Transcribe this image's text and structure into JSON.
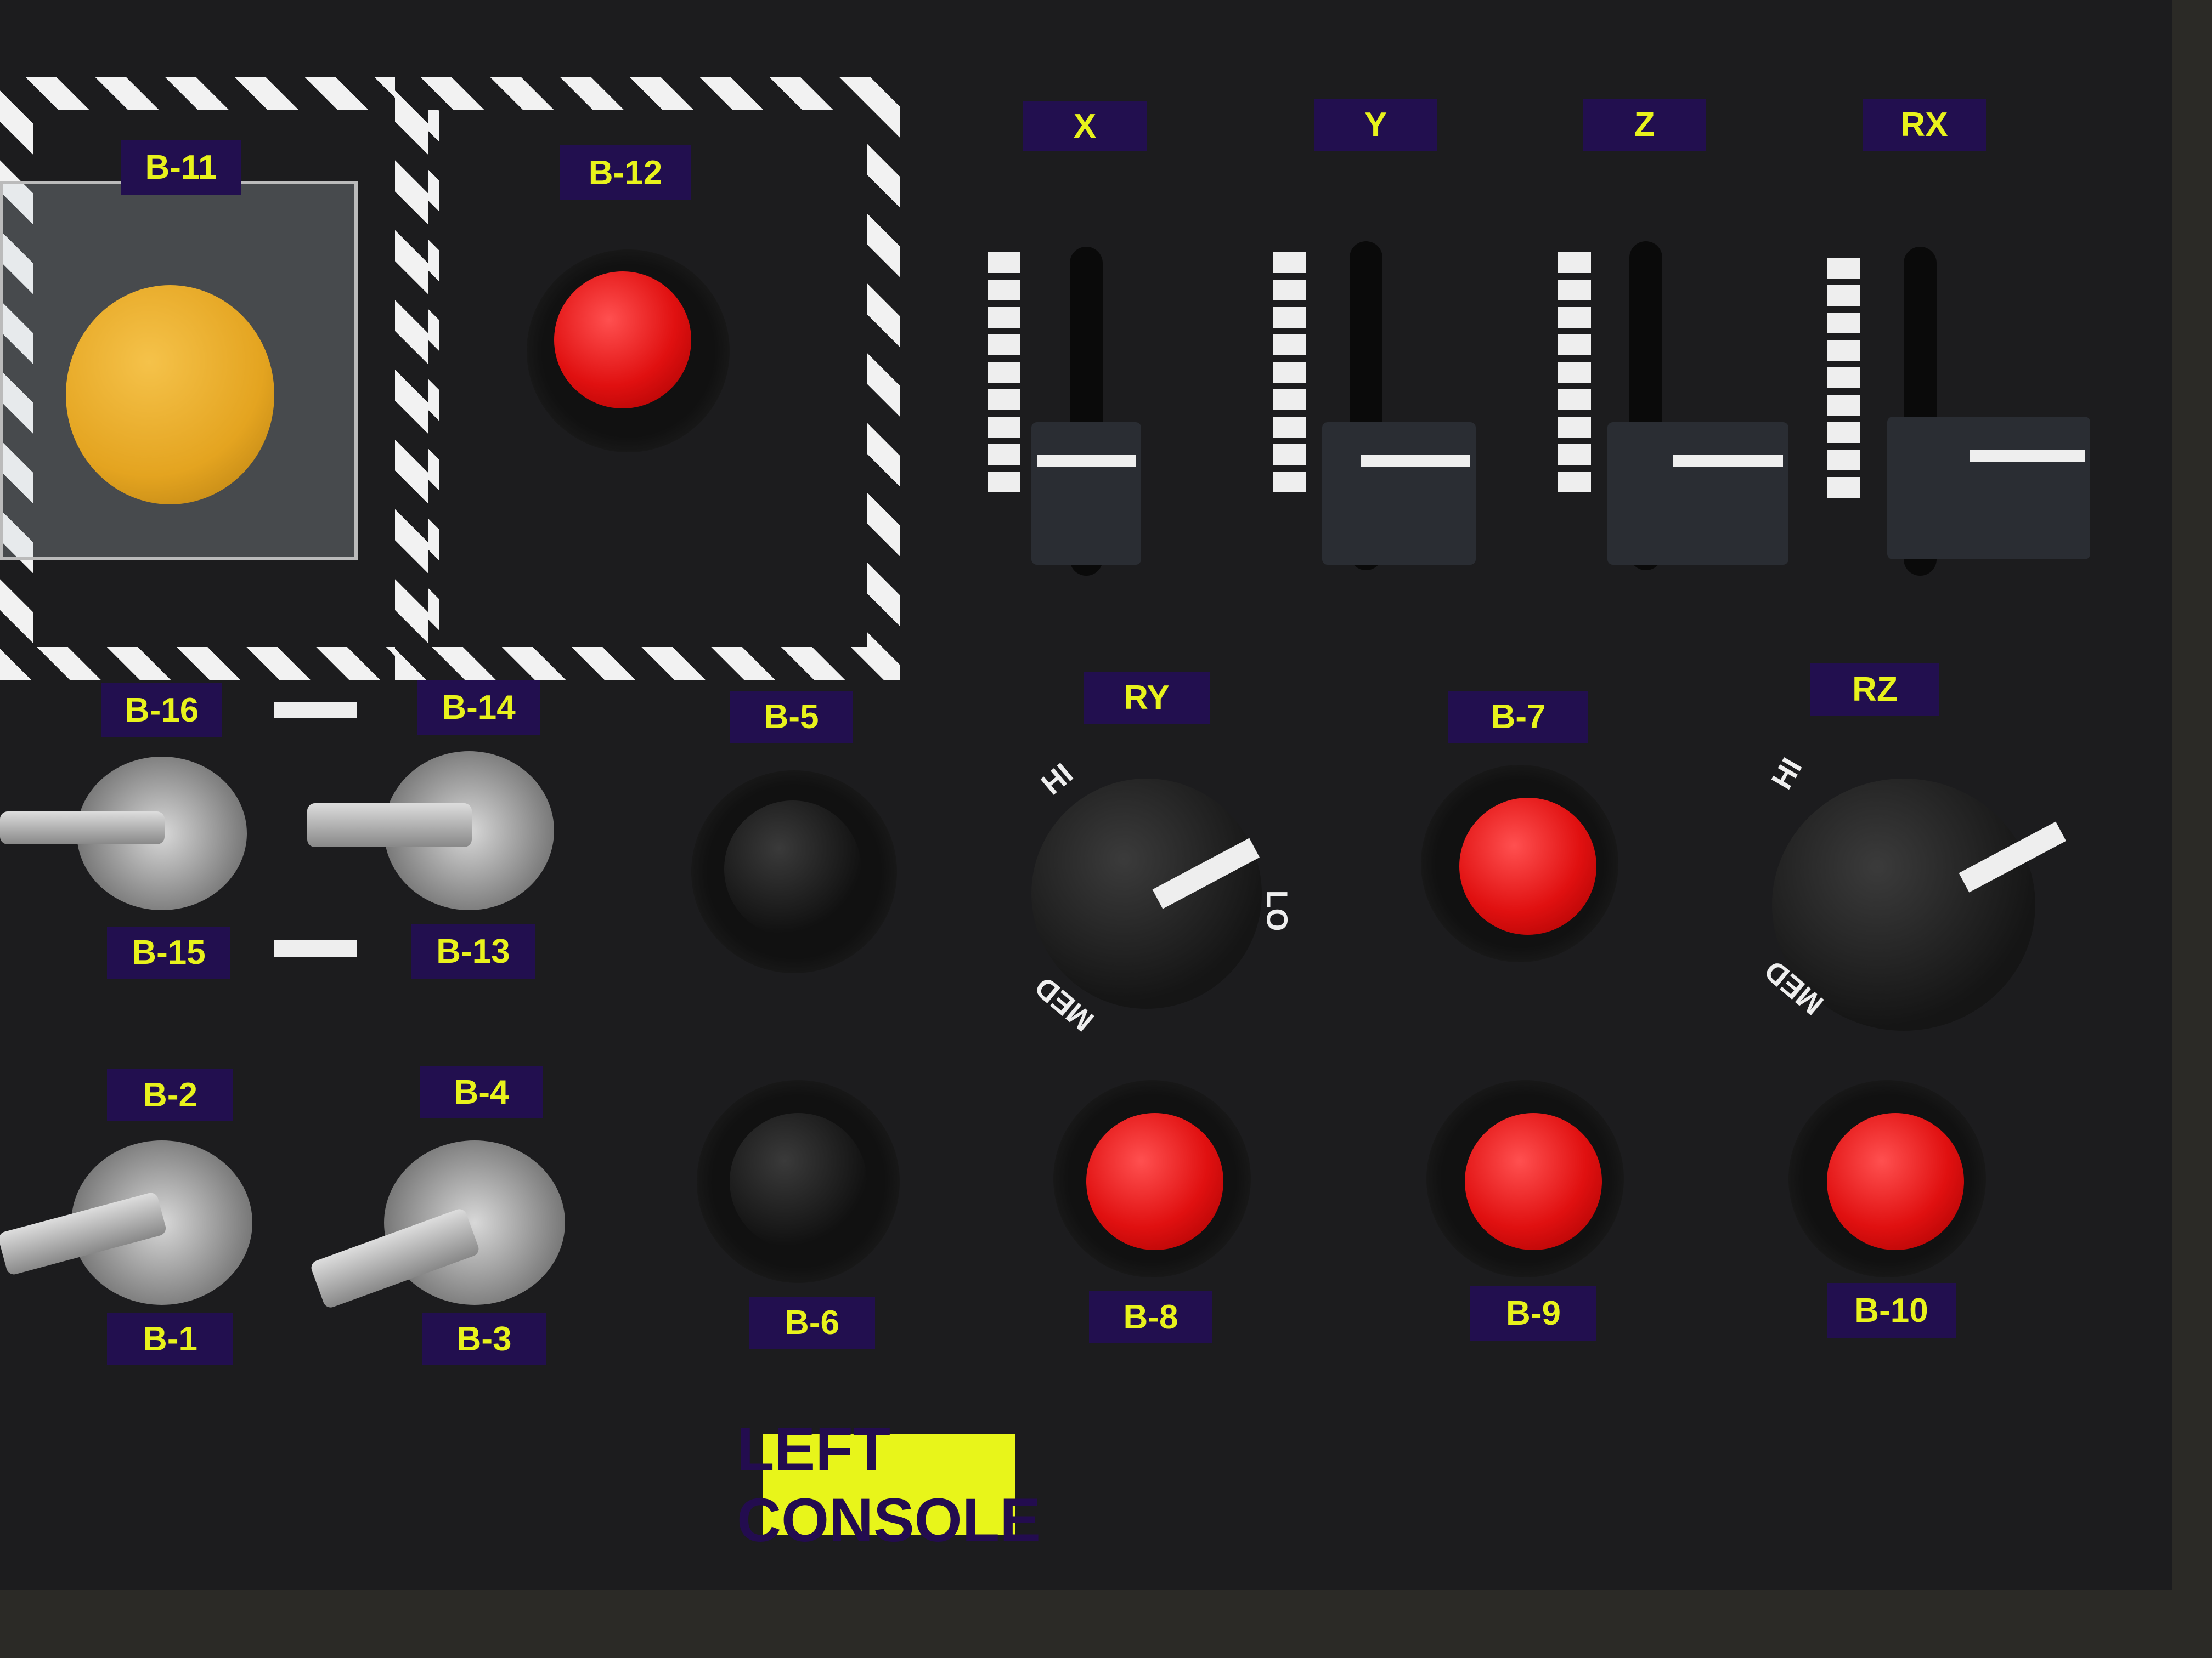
{
  "title": "LEFT CONSOLE",
  "labels": {
    "b11": "B-11",
    "b12": "B-12",
    "x": "X",
    "y": "Y",
    "z": "Z",
    "rx": "RX",
    "b16": "B-16",
    "b14": "B-14",
    "b15": "B-15",
    "b13": "B-13",
    "b5": "B-5",
    "ry": "RY",
    "b7": "B-7",
    "rz": "RZ",
    "b2": "B-2",
    "b4": "B-4",
    "b1": "B-1",
    "b3": "B-3",
    "b6": "B-6",
    "b8": "B-8",
    "b9": "B-9",
    "b10": "B-10"
  },
  "dial": {
    "hi": "HI",
    "med": "MED",
    "lo": "LO"
  },
  "colors": {
    "label_bg": "#220f4f",
    "label_text": "#e8f21c",
    "title_bg": "#e8f51a",
    "title_text": "#230c4f"
  }
}
